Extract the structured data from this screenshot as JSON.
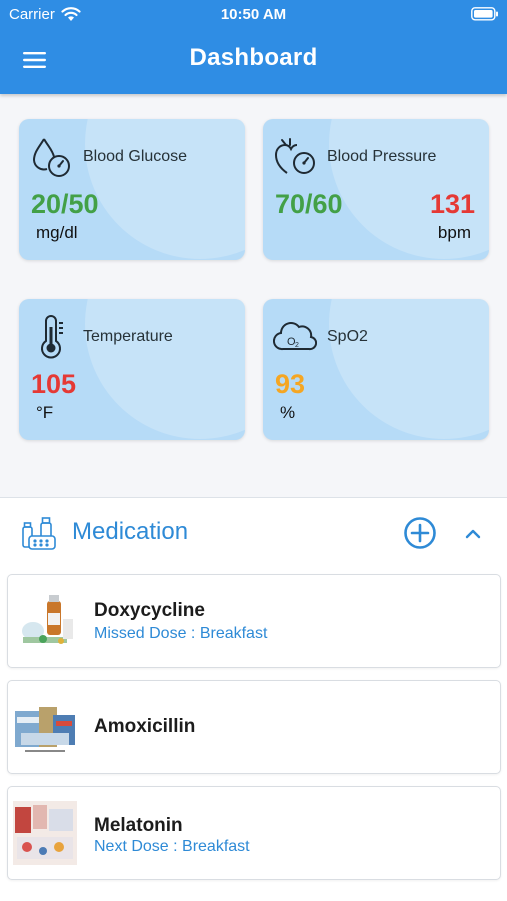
{
  "status_bar": {
    "carrier": "Carrier",
    "time": "10:50 AM",
    "wifi_icon": "wifi-icon",
    "battery_icon": "battery-icon"
  },
  "app_bar": {
    "title": "Dashboard",
    "menu_icon": "hamburger-menu-icon",
    "color": "#2f8de4"
  },
  "vitals": {
    "glucose": {
      "label": "Blood Glucose",
      "value": "20/50",
      "unit": "mg/dl",
      "value_color": "#43a047",
      "icon": "blood-drop-gauge-icon"
    },
    "pressure": {
      "label": "Blood Pressure",
      "value": "70/60",
      "value_color": "#43a047",
      "pulse": "131",
      "pulse_unit": "bpm",
      "pulse_color": "#e53935",
      "icon": "heart-gauge-icon"
    },
    "temperature": {
      "label": "Temperature",
      "value": "105",
      "unit": "°F",
      "value_color": "#e53935",
      "icon": "thermometer-icon"
    },
    "spo2": {
      "label": "SpO2",
      "value": "93",
      "unit": "%",
      "value_color": "#f5a623",
      "icon": "o2-cloud-icon"
    }
  },
  "medication": {
    "title": "Medication",
    "header_icon": "pills-bottles-icon",
    "add_icon": "add-circle-icon",
    "collapse_icon": "chevron-up-icon",
    "accent": "#2e8ad6",
    "items": [
      {
        "name": "Doxycycline",
        "status": "Missed Dose : Breakfast",
        "thumb": "medicine-bottle-image"
      },
      {
        "name": "Amoxicillin",
        "status": "",
        "thumb": "medicine-boxes-image"
      },
      {
        "name": "Melatonin",
        "status": "Next Dose : Breakfast",
        "thumb": "pills-pharmacy-image"
      }
    ]
  }
}
